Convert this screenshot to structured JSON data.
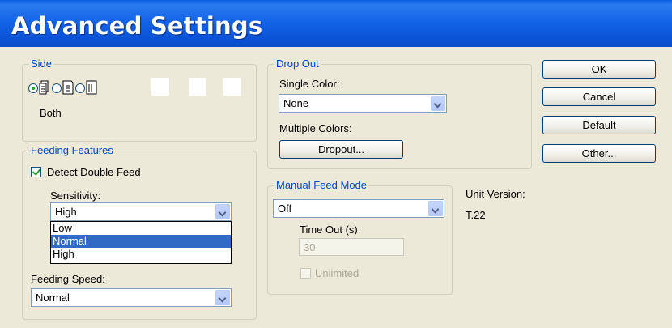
{
  "window": {
    "title": "Advanced Settings"
  },
  "side": {
    "legend": "Side",
    "legend_underline": "g",
    "selected_label": "Both",
    "options": [
      "both-sides-icon",
      "front-side-icon",
      "back-side-icon"
    ]
  },
  "feeding": {
    "legend": "Feeding Features",
    "detect_double_feed": "Detect Double Feed",
    "detect_checked": true,
    "sensitivity_label": "Sensitivity:",
    "sensitivity_value": "High",
    "sensitivity_options": [
      "Low",
      "Normal",
      "High"
    ],
    "sensitivity_highlight": "Normal",
    "speed_label": "Feeding Speed:",
    "speed_value": "Normal"
  },
  "dropout": {
    "legend": "Drop Out",
    "single_color_label": "Single Color:",
    "single_color_value": "None",
    "multiple_colors_label": "Multiple Colors:",
    "dropout_button": "Dropout..."
  },
  "manual": {
    "legend": "Manual Feed Mode",
    "mode_value": "Off",
    "timeout_label": "Time Out (s):",
    "timeout_value": "30",
    "unlimited_label": "Unlimited"
  },
  "unit": {
    "label": "Unit Version:",
    "value": "T.22"
  },
  "buttons": {
    "ok": "OK",
    "cancel": "Cancel",
    "default": "Default",
    "other": "Other..."
  }
}
